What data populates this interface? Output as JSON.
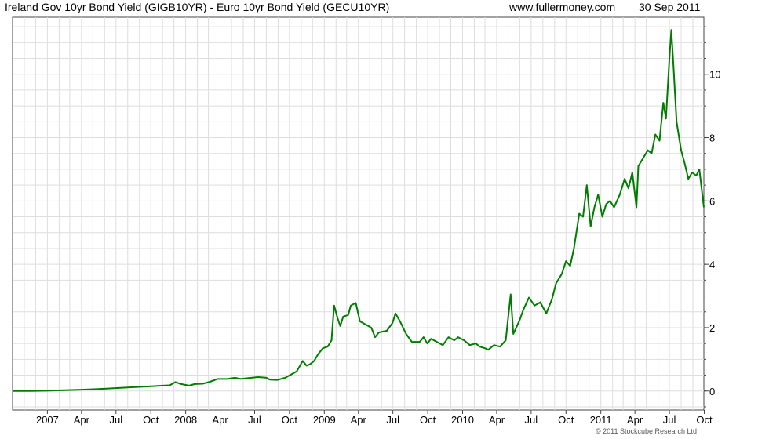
{
  "header": {
    "title": "Ireland Gov 10yr Bond Yield (GIGB10YR) - Euro 10yr Bond Yield (GECU10YR)",
    "site": "www.fullermoney.com",
    "date": "30 Sep 2011"
  },
  "footer": {
    "copyright": "© 2011 Stockcube Research Ltd"
  },
  "chart_data": {
    "type": "line",
    "title": "Ireland Gov 10yr Bond Yield (GIGB10YR) - Euro 10yr Bond Yield (GECU10YR)",
    "xlabel": "",
    "ylabel": "",
    "x_range": [
      "2006-10-01",
      "2011-09-30"
    ],
    "ylim": [
      -0.6,
      11.8
    ],
    "y_ticks": [
      0,
      2,
      4,
      6,
      8,
      10
    ],
    "x_tick_labels": [
      {
        "date": "2007-01-01",
        "label": "2007"
      },
      {
        "date": "2007-04-01",
        "label": "Apr"
      },
      {
        "date": "2007-07-01",
        "label": "Jul"
      },
      {
        "date": "2007-10-01",
        "label": "Oct"
      },
      {
        "date": "2008-01-01",
        "label": "2008"
      },
      {
        "date": "2008-04-01",
        "label": "Apr"
      },
      {
        "date": "2008-07-01",
        "label": "Jul"
      },
      {
        "date": "2008-10-01",
        "label": "Oct"
      },
      {
        "date": "2009-01-01",
        "label": "2009"
      },
      {
        "date": "2009-04-01",
        "label": "Apr"
      },
      {
        "date": "2009-07-01",
        "label": "Jul"
      },
      {
        "date": "2009-10-01",
        "label": "Oct"
      },
      {
        "date": "2010-01-01",
        "label": "2010"
      },
      {
        "date": "2010-04-01",
        "label": "Apr"
      },
      {
        "date": "2010-07-01",
        "label": "Jul"
      },
      {
        "date": "2010-10-01",
        "label": "Oct"
      },
      {
        "date": "2011-01-01",
        "label": "2011"
      },
      {
        "date": "2011-04-01",
        "label": "Apr"
      },
      {
        "date": "2011-07-01",
        "label": "Jul"
      },
      {
        "date": "2011-10-01",
        "label": "Oct"
      }
    ],
    "grid": true,
    "y_axis_side": "right",
    "line_color": "#007d00",
    "series": [
      {
        "values": [
          {
            "x": "2006-10-01",
            "y": 0.0
          },
          {
            "x": "2006-11-15",
            "y": 0.0
          },
          {
            "x": "2007-01-01",
            "y": 0.01
          },
          {
            "x": "2007-04-01",
            "y": 0.04
          },
          {
            "x": "2007-06-01",
            "y": 0.07
          },
          {
            "x": "2007-08-01",
            "y": 0.11
          },
          {
            "x": "2007-10-01",
            "y": 0.15
          },
          {
            "x": "2007-11-01",
            "y": 0.17
          },
          {
            "x": "2007-11-20",
            "y": 0.18
          },
          {
            "x": "2007-12-05",
            "y": 0.28
          },
          {
            "x": "2007-12-20",
            "y": 0.22
          },
          {
            "x": "2008-01-10",
            "y": 0.17
          },
          {
            "x": "2008-01-25",
            "y": 0.22
          },
          {
            "x": "2008-02-15",
            "y": 0.23
          },
          {
            "x": "2008-03-05",
            "y": 0.29
          },
          {
            "x": "2008-03-25",
            "y": 0.38
          },
          {
            "x": "2008-04-20",
            "y": 0.38
          },
          {
            "x": "2008-05-10",
            "y": 0.42
          },
          {
            "x": "2008-05-25",
            "y": 0.38
          },
          {
            "x": "2008-06-15",
            "y": 0.41
          },
          {
            "x": "2008-07-10",
            "y": 0.44
          },
          {
            "x": "2008-07-31",
            "y": 0.42
          },
          {
            "x": "2008-08-10",
            "y": 0.36
          },
          {
            "x": "2008-08-30",
            "y": 0.35
          },
          {
            "x": "2008-09-20",
            "y": 0.42
          },
          {
            "x": "2008-10-10",
            "y": 0.55
          },
          {
            "x": "2008-10-20",
            "y": 0.62
          },
          {
            "x": "2008-11-05",
            "y": 0.95
          },
          {
            "x": "2008-11-15",
            "y": 0.8
          },
          {
            "x": "2008-11-25",
            "y": 0.85
          },
          {
            "x": "2008-12-05",
            "y": 0.95
          },
          {
            "x": "2008-12-15",
            "y": 1.15
          },
          {
            "x": "2008-12-28",
            "y": 1.35
          },
          {
            "x": "2009-01-10",
            "y": 1.4
          },
          {
            "x": "2009-01-20",
            "y": 1.6
          },
          {
            "x": "2009-01-27",
            "y": 2.7
          },
          {
            "x": "2009-02-05",
            "y": 2.3
          },
          {
            "x": "2009-02-12",
            "y": 2.05
          },
          {
            "x": "2009-02-20",
            "y": 2.35
          },
          {
            "x": "2009-03-05",
            "y": 2.4
          },
          {
            "x": "2009-03-12",
            "y": 2.7
          },
          {
            "x": "2009-03-25",
            "y": 2.78
          },
          {
            "x": "2009-04-05",
            "y": 2.2
          },
          {
            "x": "2009-04-20",
            "y": 2.1
          },
          {
            "x": "2009-05-05",
            "y": 2.0
          },
          {
            "x": "2009-05-15",
            "y": 1.7
          },
          {
            "x": "2009-05-25",
            "y": 1.85
          },
          {
            "x": "2009-06-15",
            "y": 1.9
          },
          {
            "x": "2009-06-30",
            "y": 2.15
          },
          {
            "x": "2009-07-08",
            "y": 2.45
          },
          {
            "x": "2009-07-20",
            "y": 2.2
          },
          {
            "x": "2009-08-05",
            "y": 1.8
          },
          {
            "x": "2009-08-20",
            "y": 1.55
          },
          {
            "x": "2009-09-10",
            "y": 1.55
          },
          {
            "x": "2009-09-20",
            "y": 1.7
          },
          {
            "x": "2009-09-30",
            "y": 1.5
          },
          {
            "x": "2009-10-10",
            "y": 1.65
          },
          {
            "x": "2009-10-25",
            "y": 1.55
          },
          {
            "x": "2009-11-10",
            "y": 1.45
          },
          {
            "x": "2009-11-25",
            "y": 1.7
          },
          {
            "x": "2009-12-10",
            "y": 1.6
          },
          {
            "x": "2009-12-20",
            "y": 1.7
          },
          {
            "x": "2010-01-05",
            "y": 1.6
          },
          {
            "x": "2010-01-20",
            "y": 1.45
          },
          {
            "x": "2010-02-05",
            "y": 1.5
          },
          {
            "x": "2010-02-15",
            "y": 1.4
          },
          {
            "x": "2010-03-01",
            "y": 1.35
          },
          {
            "x": "2010-03-10",
            "y": 1.3
          },
          {
            "x": "2010-03-25",
            "y": 1.45
          },
          {
            "x": "2010-04-10",
            "y": 1.4
          },
          {
            "x": "2010-04-25",
            "y": 1.6
          },
          {
            "x": "2010-05-08",
            "y": 3.05
          },
          {
            "x": "2010-05-15",
            "y": 1.8
          },
          {
            "x": "2010-06-01",
            "y": 2.25
          },
          {
            "x": "2010-06-10",
            "y": 2.55
          },
          {
            "x": "2010-06-25",
            "y": 2.95
          },
          {
            "x": "2010-07-10",
            "y": 2.7
          },
          {
            "x": "2010-07-25",
            "y": 2.8
          },
          {
            "x": "2010-08-10",
            "y": 2.45
          },
          {
            "x": "2010-08-25",
            "y": 2.9
          },
          {
            "x": "2010-09-05",
            "y": 3.4
          },
          {
            "x": "2010-09-20",
            "y": 3.7
          },
          {
            "x": "2010-10-01",
            "y": 4.1
          },
          {
            "x": "2010-10-12",
            "y": 3.95
          },
          {
            "x": "2010-10-22",
            "y": 4.5
          },
          {
            "x": "2010-11-05",
            "y": 5.6
          },
          {
            "x": "2010-11-15",
            "y": 5.5
          },
          {
            "x": "2010-11-25",
            "y": 6.5
          },
          {
            "x": "2010-12-05",
            "y": 5.2
          },
          {
            "x": "2010-12-15",
            "y": 5.8
          },
          {
            "x": "2010-12-25",
            "y": 6.2
          },
          {
            "x": "2011-01-05",
            "y": 5.5
          },
          {
            "x": "2011-01-15",
            "y": 5.9
          },
          {
            "x": "2011-01-25",
            "y": 6.0
          },
          {
            "x": "2011-02-05",
            "y": 5.8
          },
          {
            "x": "2011-02-20",
            "y": 6.2
          },
          {
            "x": "2011-03-05",
            "y": 6.7
          },
          {
            "x": "2011-03-15",
            "y": 6.4
          },
          {
            "x": "2011-03-25",
            "y": 6.9
          },
          {
            "x": "2011-04-05",
            "y": 5.8
          },
          {
            "x": "2011-04-10",
            "y": 7.1
          },
          {
            "x": "2011-04-25",
            "y": 7.4
          },
          {
            "x": "2011-05-05",
            "y": 7.6
          },
          {
            "x": "2011-05-15",
            "y": 7.5
          },
          {
            "x": "2011-05-25",
            "y": 8.1
          },
          {
            "x": "2011-06-05",
            "y": 7.9
          },
          {
            "x": "2011-06-15",
            "y": 9.1
          },
          {
            "x": "2011-06-22",
            "y": 8.6
          },
          {
            "x": "2011-07-01",
            "y": 10.5
          },
          {
            "x": "2011-07-06",
            "y": 11.4
          },
          {
            "x": "2011-07-12",
            "y": 10.2
          },
          {
            "x": "2011-07-20",
            "y": 8.5
          },
          {
            "x": "2011-08-01",
            "y": 7.6
          },
          {
            "x": "2011-08-10",
            "y": 7.2
          },
          {
            "x": "2011-08-20",
            "y": 6.7
          },
          {
            "x": "2011-08-30",
            "y": 6.9
          },
          {
            "x": "2011-09-10",
            "y": 6.8
          },
          {
            "x": "2011-09-18",
            "y": 7.0
          },
          {
            "x": "2011-09-30",
            "y": 5.8
          }
        ]
      }
    ]
  }
}
